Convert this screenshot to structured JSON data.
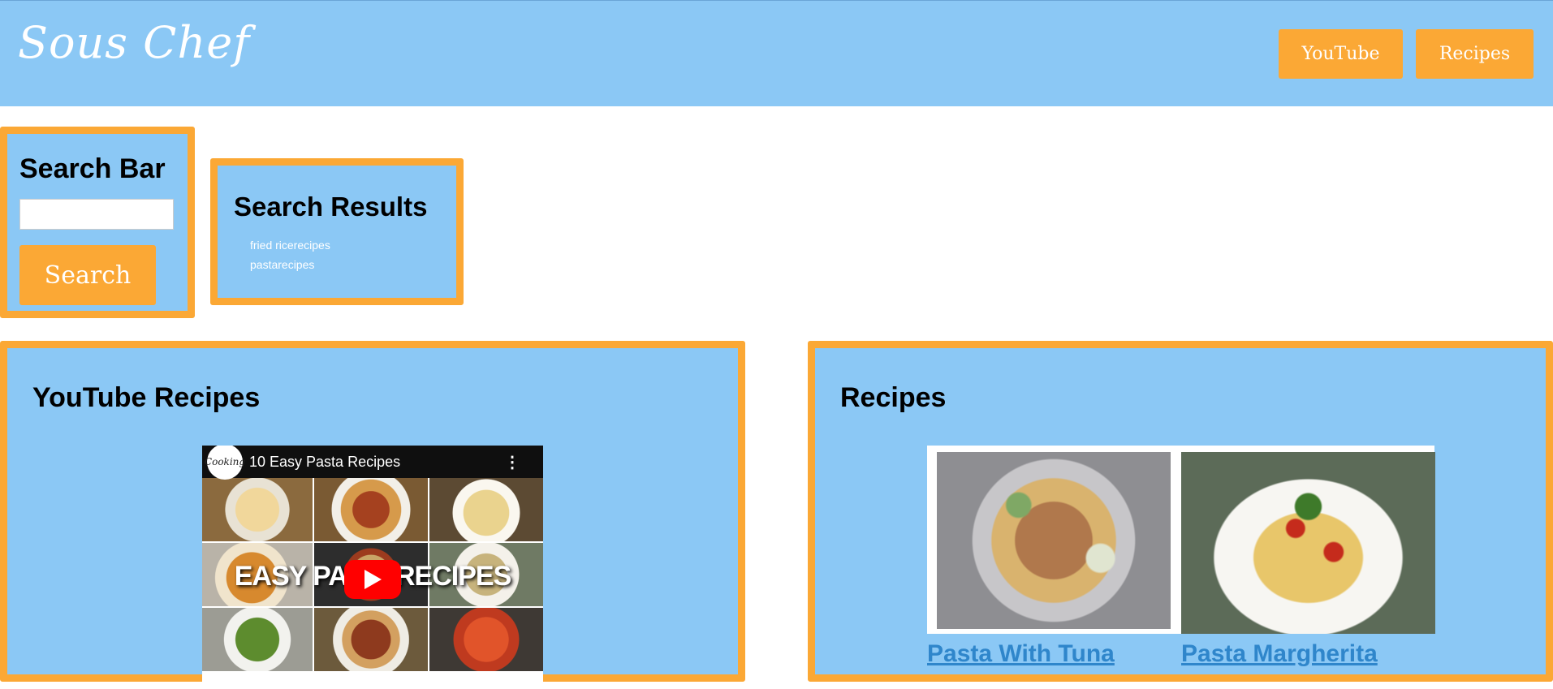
{
  "header": {
    "brand": "Sous Chef",
    "nav": {
      "youtube": "YouTube",
      "recipes": "Recipes"
    }
  },
  "search": {
    "title": "Search Bar",
    "input_value": "",
    "button_label": "Search"
  },
  "results": {
    "title": "Search Results",
    "items": [
      "fried ricerecipes",
      "pastarecipes"
    ]
  },
  "youtube": {
    "title": "YouTube Recipes",
    "video": {
      "title": "10 Easy Pasta Recipes",
      "channel_badge": "Cooking",
      "overlay": "EASY PA       RECIPES"
    }
  },
  "recipes": {
    "title": "Recipes",
    "items": [
      {
        "name": "Pasta With Tuna"
      },
      {
        "name": "Pasta Margherita"
      }
    ]
  },
  "colors": {
    "panel_bg": "#8bc8f5",
    "accent": "#fba835",
    "link": "#2f86cb",
    "youtube_red": "#ff0000"
  }
}
